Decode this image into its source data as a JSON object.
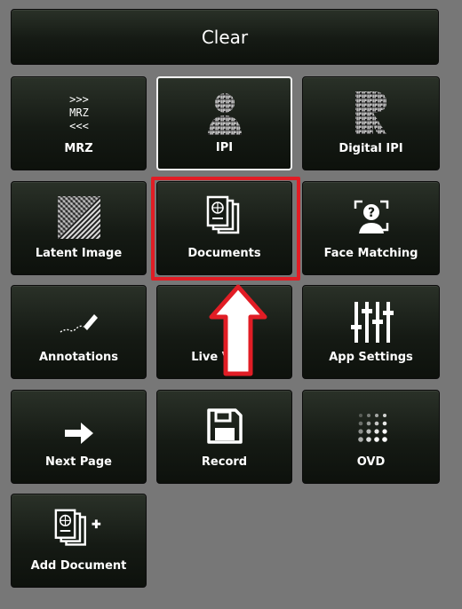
{
  "clear_label": "Clear",
  "buttons": {
    "mrz": {
      "label": "MRZ",
      "icon": "mrz-icon",
      "glyph": ">>>\nMRZ\n<<<"
    },
    "ipi": {
      "label": "IPI",
      "icon": "ipi-icon"
    },
    "digital_ipi": {
      "label": "Digital IPI",
      "icon": "digital-ipi-icon"
    },
    "latent_image": {
      "label": "Latent Image",
      "icon": "latent-image-icon"
    },
    "documents": {
      "label": "Documents",
      "icon": "passport-icon"
    },
    "face_matching": {
      "label": "Face Matching",
      "icon": "face-matching-icon"
    },
    "annotations": {
      "label": "Annotations",
      "icon": "pen-icon"
    },
    "live_view": {
      "label": "Live V",
      "icon": "live-view-icon"
    },
    "app_settings": {
      "label": "App Settings",
      "icon": "sliders-icon"
    },
    "next_page": {
      "label": "Next Page",
      "icon": "arrow-right-icon"
    },
    "record": {
      "label": "Record",
      "icon": "floppy-disk-icon"
    },
    "ovd": {
      "label": "OVD",
      "icon": "dot-grid-icon"
    },
    "add_document": {
      "label": "Add Document",
      "icon": "add-passport-icon"
    }
  },
  "colors": {
    "highlight": "#e11d25",
    "background": "#777777",
    "button": "#151a14"
  }
}
